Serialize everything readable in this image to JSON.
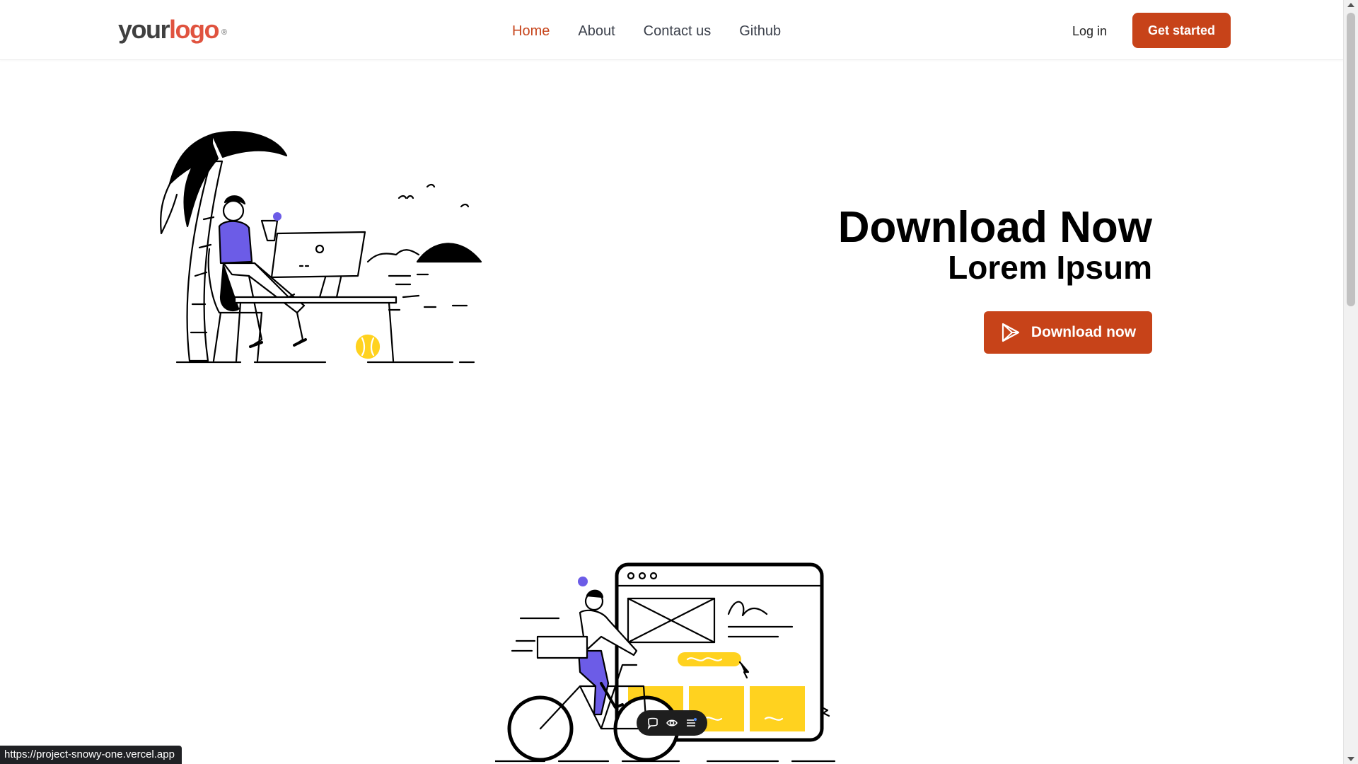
{
  "header": {
    "logo": {
      "word1": "your",
      "word2": "logo",
      "mark": "®"
    },
    "nav": [
      "Home",
      "About",
      "Contact us",
      "Github"
    ],
    "login_label": "Log in",
    "cta_label": "Get started"
  },
  "hero": {
    "title": "Download Now",
    "subtitle": "Lorem Ipsum",
    "download_label": "Download now",
    "illustration": "person-working-on-laptop-under-palm-tree"
  },
  "section2": {
    "illustration": "cyclist-with-browser-wireframe",
    "toolbar_icons": [
      "comment-icon",
      "eye-icon",
      "menu-icon"
    ]
  },
  "status_bar": {
    "url": "https://project-snowy-one.vercel.app"
  },
  "colors": {
    "accent": "#c74319",
    "nav_active": "#c7461d",
    "logo_accent": "#e0533f",
    "illustration_purple": "#6c5ce7",
    "illustration_yellow": "#ffd21f"
  },
  "icons": {
    "download_icon": "play-store-icon"
  }
}
